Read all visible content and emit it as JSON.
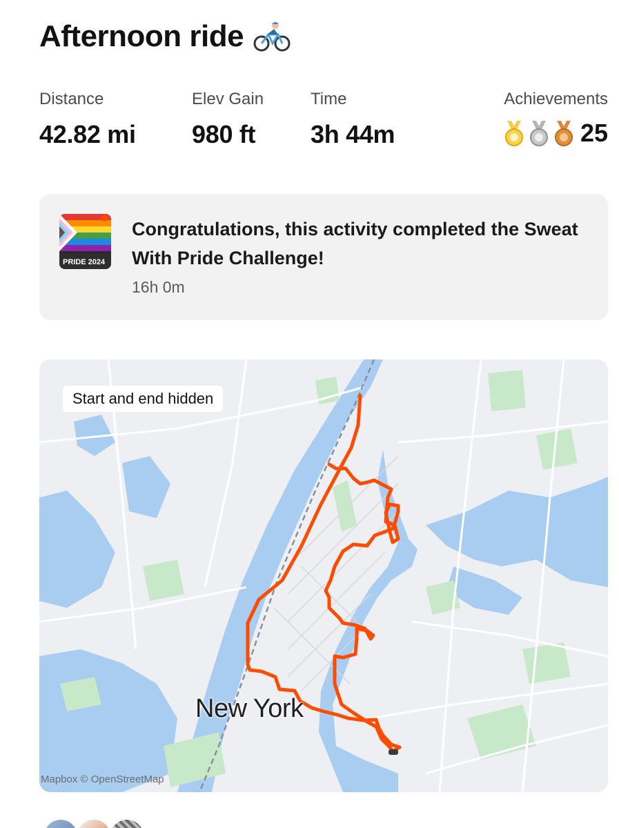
{
  "activity": {
    "title": "Afternoon ride",
    "title_icon": "cyclist-emoji"
  },
  "stats": {
    "distance": {
      "label": "Distance",
      "value": "42.82 mi"
    },
    "elev_gain": {
      "label": "Elev Gain",
      "value": "980 ft"
    },
    "time": {
      "label": "Time",
      "value": "3h 44m"
    },
    "achievements": {
      "label": "Achievements",
      "count": "25",
      "medals": [
        "gold-medal-icon",
        "silver-medal-icon",
        "bronze-medal-icon"
      ]
    }
  },
  "challenge": {
    "badge_text": "PRIDE 2024",
    "message": "Congratulations, this activity completed the Sweat With Pride Challenge!",
    "time_ago": "16h 0m"
  },
  "map": {
    "privacy_label": "Start and end hidden",
    "city_label": "New York",
    "attribution": "Mapbox © OpenStreetMap",
    "route_color": "#fc4c02",
    "water_color": "#a9cdf0",
    "park_color": "#c7e8c9"
  },
  "kudos": {
    "avatars": [
      "avatar-1",
      "avatar-2",
      "avatar-3"
    ]
  }
}
